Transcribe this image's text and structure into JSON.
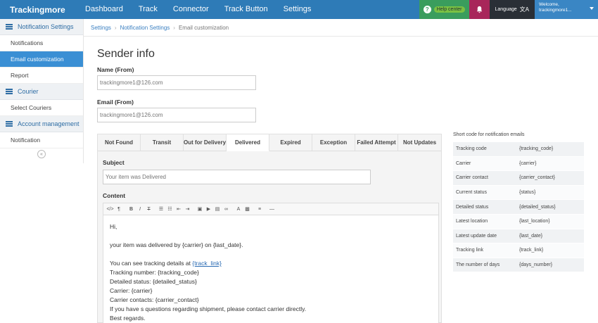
{
  "brand": "Trackingmore",
  "nav": [
    "Dashboard",
    "Track",
    "Connector",
    "Track Button",
    "Settings"
  ],
  "header": {
    "help_label": "Help center",
    "language_label": "Language",
    "language_glyph": "文A",
    "welcome_line1": "Welcome,",
    "welcome_line2": "trackingmore1..."
  },
  "sidebar": {
    "groups": [
      {
        "label": "Notification Settings",
        "items": [
          "Notifications",
          "Email customization",
          "Report"
        ]
      },
      {
        "label": "Courier",
        "items": [
          "Select Couriers"
        ]
      },
      {
        "label": "Account management",
        "items": [
          "Notification"
        ]
      }
    ],
    "active_item": "Email customization",
    "collapse_glyph": "«"
  },
  "breadcrumb": {
    "items": [
      "Settings",
      "Notification Settings",
      "Email customization"
    ],
    "separator": "›"
  },
  "sender": {
    "title": "Sender info",
    "name_label": "Name (From)",
    "name_placeholder": "trackingmore1@126.com",
    "email_label": "Email (From)",
    "email_placeholder": "trackingmore1@126.com"
  },
  "tabs": [
    "Not Found",
    "Transit",
    "Out for Delivery",
    "Delivered",
    "Expired",
    "Exception",
    "Failed Attempt",
    "Not Updates"
  ],
  "active_tab": "Delivered",
  "editor": {
    "subject_label": "Subject",
    "subject_placeholder": "Your item was Delivered",
    "content_label": "Content",
    "toolbar": [
      "</>",
      "¶",
      "B",
      "I",
      "T",
      "☰",
      "☷",
      "⇤",
      "⇥",
      "▣",
      "▶",
      "▤",
      "∞",
      "A",
      "▩",
      "≡",
      "—"
    ],
    "greeting": "Hi,",
    "line1": "your item was delivered by {carrier} on {last_date}.",
    "line2_prefix": "You can see tracking details at ",
    "line2_link": "{track_link}",
    "line3": "Tracking number: {tracking_code}",
    "line4": "Detailed status: {detailed_status}",
    "line5": "Carrier: {carrier}",
    "line6": "Carrier contacts: {carrier_contact}",
    "line7": "If you have s questions regarding shipment, please contact carrier directly.",
    "line8": "Best regards."
  },
  "shortcodes": {
    "title": "Short code for notification emails",
    "rows": [
      {
        "name": "Tracking code",
        "code": "{tracking_code}"
      },
      {
        "name": "Carrier",
        "code": "{carrier}"
      },
      {
        "name": "Carrier contact",
        "code": "{carrier_contact}"
      },
      {
        "name": "Current status",
        "code": "{status}"
      },
      {
        "name": "Detailed status",
        "code": "{detailed_status}"
      },
      {
        "name": "Latest location",
        "code": "{last_location}"
      },
      {
        "name": "Latest update date",
        "code": "{last_date}"
      },
      {
        "name": "Tracking link",
        "code": "{track_link}"
      },
      {
        "name": "The number of days",
        "code": "{days_number}"
      }
    ]
  }
}
